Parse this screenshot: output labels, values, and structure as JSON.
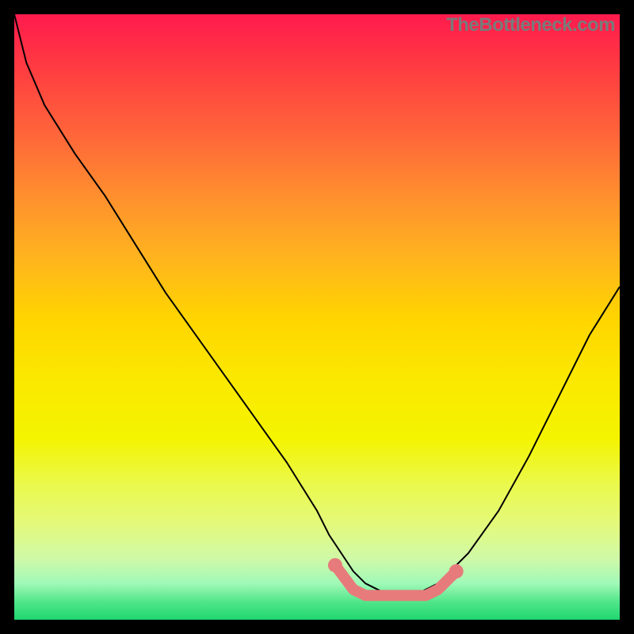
{
  "watermark": "TheBottleneck.com",
  "chart_data": {
    "type": "line",
    "title": "",
    "xlabel": "",
    "ylabel": "",
    "xlim": [
      0,
      100
    ],
    "ylim": [
      0,
      100
    ],
    "series": [
      {
        "name": "curve",
        "x": [
          0,
          2,
          5,
          10,
          15,
          20,
          25,
          30,
          35,
          40,
          45,
          50,
          52,
          54,
          56,
          58,
          60,
          62,
          64,
          66,
          68,
          70,
          75,
          80,
          85,
          90,
          95,
          100
        ],
        "values": [
          100,
          92,
          85,
          77,
          70,
          62,
          54,
          47,
          40,
          33,
          26,
          18,
          14,
          11,
          8,
          6,
          5,
          4,
          4,
          4,
          5,
          6,
          11,
          18,
          27,
          37,
          47,
          55
        ]
      },
      {
        "name": "marker-band",
        "x": [
          53,
          56,
          58,
          60,
          62,
          64,
          66,
          68,
          70,
          73
        ],
        "values": [
          9,
          5,
          4,
          4,
          4,
          4,
          4,
          4,
          5,
          8
        ]
      }
    ]
  }
}
